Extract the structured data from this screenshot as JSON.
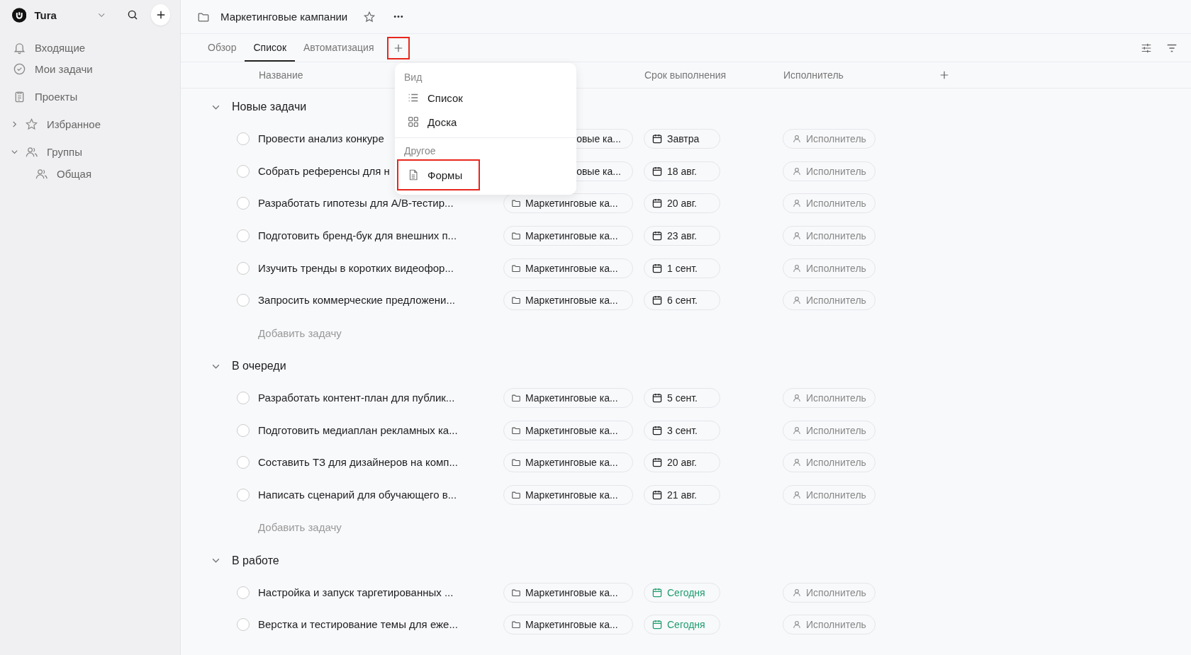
{
  "workspace": {
    "name": "Tura"
  },
  "sidebar": {
    "items": [
      {
        "kind": "inbox",
        "label": "Входящие"
      },
      {
        "kind": "mytasks",
        "label": "Мои задачи"
      },
      {
        "kind": "projects",
        "label": "Проекты"
      },
      {
        "kind": "favorites",
        "label": "Избранное",
        "expanded": false
      },
      {
        "kind": "groups",
        "label": "Группы",
        "expanded": true,
        "children": [
          {
            "label": "Общая"
          }
        ]
      }
    ]
  },
  "project": {
    "title": "Маркетинговые кампании"
  },
  "tabs": [
    {
      "label": "Обзор",
      "selected": false
    },
    {
      "label": "Список",
      "selected": true
    },
    {
      "label": "Автоматизация",
      "selected": false
    }
  ],
  "add_view_button": {
    "highlighted": true
  },
  "columns": [
    "Название",
    "Срок выполнения",
    "Исполнитель"
  ],
  "view_menu": {
    "sections": [
      {
        "title": "Вид",
        "items": [
          {
            "kind": "list",
            "label": "Список",
            "highlighted": false
          },
          {
            "kind": "board",
            "label": "Доска",
            "highlighted": false
          }
        ]
      },
      {
        "title": "Другое",
        "items": [
          {
            "kind": "form",
            "label": "Формы",
            "highlighted": true
          }
        ]
      }
    ]
  },
  "groups": [
    {
      "title": "Новые задачи",
      "expanded": true,
      "add_label": "Добавить задачу",
      "tasks": [
        {
          "name": "Провести анализ конкуре",
          "done": false,
          "project": "овые ка...",
          "project_covered": true,
          "due": "Завтра",
          "due_today": false,
          "assignee": "Исполнитель"
        },
        {
          "name": "Собрать референсы для н",
          "done": false,
          "project": "овые ка...",
          "project_covered": true,
          "due": "18 авг.",
          "due_today": false,
          "assignee": "Исполнитель"
        },
        {
          "name": "Разработать гипотезы для A/B-тестир...",
          "done": false,
          "project": "Маркетинговые ка...",
          "project_covered": false,
          "due": "20 авг.",
          "due_today": false,
          "assignee": "Исполнитель"
        },
        {
          "name": "Подготовить бренд-бук для внешних п...",
          "done": false,
          "project": "Маркетинговые ка...",
          "project_covered": false,
          "due": "23 авг.",
          "due_today": false,
          "assignee": "Исполнитель"
        },
        {
          "name": "Изучить тренды в коротких видеофор...",
          "done": false,
          "project": "Маркетинговые ка...",
          "project_covered": false,
          "due": "1 сент.",
          "due_today": false,
          "assignee": "Исполнитель"
        },
        {
          "name": "Запросить коммерческие предложени...",
          "done": false,
          "project": "Маркетинговые ка...",
          "project_covered": false,
          "due": "6 сент.",
          "due_today": false,
          "assignee": "Исполнитель"
        }
      ]
    },
    {
      "title": "В очереди",
      "expanded": true,
      "add_label": "Добавить задачу",
      "tasks": [
        {
          "name": "Разработать контент-план для публик...",
          "done": false,
          "project": "Маркетинговые ка...",
          "project_covered": false,
          "due": "5 сент.",
          "due_today": false,
          "assignee": "Исполнитель"
        },
        {
          "name": "Подготовить медиаплан рекламных ка...",
          "done": false,
          "project": "Маркетинговые ка...",
          "project_covered": false,
          "due": "3 сент.",
          "due_today": false,
          "assignee": "Исполнитель"
        },
        {
          "name": "Составить ТЗ для дизайнеров на комп...",
          "done": false,
          "project": "Маркетинговые ка...",
          "project_covered": false,
          "due": "20 авг.",
          "due_today": false,
          "assignee": "Исполнитель"
        },
        {
          "name": "Написать сценарий для обучающего в...",
          "done": false,
          "project": "Маркетинговые ка...",
          "project_covered": false,
          "due": "21 авг.",
          "due_today": false,
          "assignee": "Исполнитель"
        }
      ]
    },
    {
      "title": "В работе",
      "expanded": true,
      "tasks": [
        {
          "name": "Настройка и запуск таргетированных ...",
          "done": false,
          "project": "Маркетинговые ка...",
          "project_covered": false,
          "due": "Сегодня",
          "due_today": true,
          "assignee": "Исполнитель"
        },
        {
          "name": "Верстка и тестирование темы для еже...",
          "done": false,
          "project": "Маркетинговые ка...",
          "project_covered": false,
          "due": "Сегодня",
          "due_today": true,
          "assignee": "Исполнитель"
        }
      ]
    }
  ]
}
